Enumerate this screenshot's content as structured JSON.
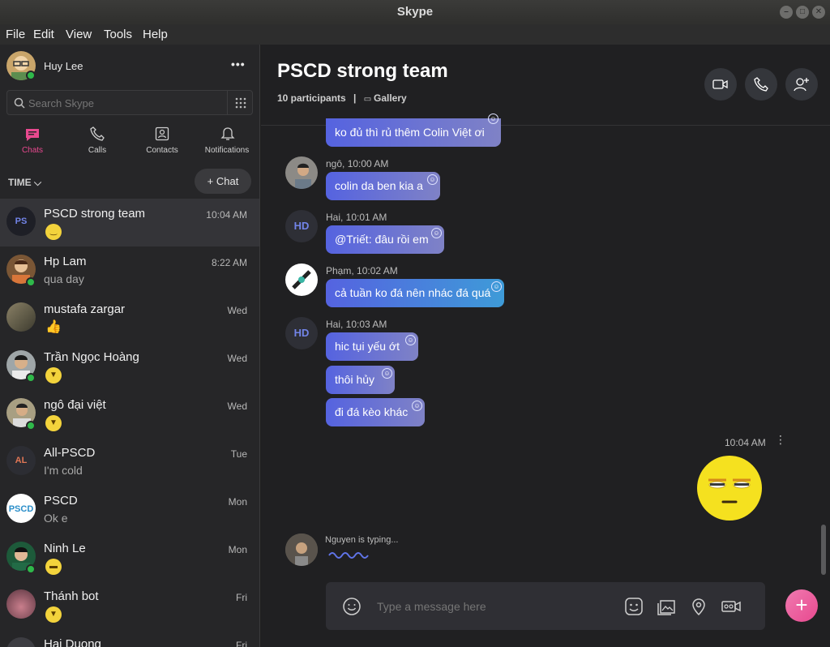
{
  "window": {
    "title": "Skype"
  },
  "menubar": {
    "items": [
      "File",
      "Edit",
      "View",
      "Tools",
      "Help"
    ]
  },
  "profile": {
    "name": "Huy Lee",
    "more_label": "•••"
  },
  "search": {
    "placeholder": "Search Skype"
  },
  "nav": {
    "chats": "Chats",
    "calls": "Calls",
    "contacts": "Contacts",
    "notifications": "Notifications"
  },
  "list_header": {
    "sort_label": "TIME",
    "new_chat_label": "Chat"
  },
  "chats": [
    {
      "name": "PSCD strong team",
      "time": "10:04 AM",
      "preview": "",
      "initials": "PS"
    },
    {
      "name": "Hp Lam",
      "time": "8:22 AM",
      "preview": "qua day",
      "initials": ""
    },
    {
      "name": "mustafa zargar",
      "time": "Wed",
      "preview": "",
      "initials": ""
    },
    {
      "name": "Trần Ngọc Hoàng",
      "time": "Wed",
      "preview": "",
      "initials": ""
    },
    {
      "name": "ngô đại việt",
      "time": "Wed",
      "preview": "",
      "initials": ""
    },
    {
      "name": "All-PSCD",
      "time": "Tue",
      "preview": "I'm cold",
      "initials": "AL"
    },
    {
      "name": "PSCD",
      "time": "Mon",
      "preview": "Ok e",
      "initials": ""
    },
    {
      "name": "Ninh Le",
      "time": "Mon",
      "preview": "",
      "initials": ""
    },
    {
      "name": "Thánh bot",
      "time": "Fri",
      "preview": "",
      "initials": ""
    },
    {
      "name": "Hai Duong",
      "time": "Fri",
      "preview": "",
      "initials": ""
    }
  ],
  "conversation": {
    "title": "PSCD strong team",
    "participants": "10 participants",
    "separator": "|",
    "gallery_label": "Gallery"
  },
  "messages": [
    {
      "sender": "",
      "text": "ko đủ thì rủ thêm Colin Việt ơi"
    },
    {
      "sender": "ngô, 10:00 AM",
      "text": "colin da ben kia a"
    },
    {
      "sender": "Hai, 10:01 AM",
      "text": "@Triết: đâu rồi em",
      "initials": "HD"
    },
    {
      "sender": "Phạm, 10:02 AM",
      "text": "cả tuần ko đá nên nhác đá quá"
    },
    {
      "sender": "Hai, 10:03 AM",
      "text": "hic tụi yếu ớt",
      "initials": "HD"
    },
    {
      "sender": "",
      "text": "thôi hủy"
    },
    {
      "sender": "",
      "text": "đi đá kèo khác"
    }
  ],
  "own_message": {
    "time": "10:04 AM"
  },
  "typing": {
    "text": "Nguyen is typing..."
  },
  "compose": {
    "placeholder": "Type a message here"
  },
  "colors": {
    "accent": "#e8498f",
    "bubble_start": "#5563e0",
    "bubble_end": "#7f82c6",
    "online": "#2fb94a"
  }
}
